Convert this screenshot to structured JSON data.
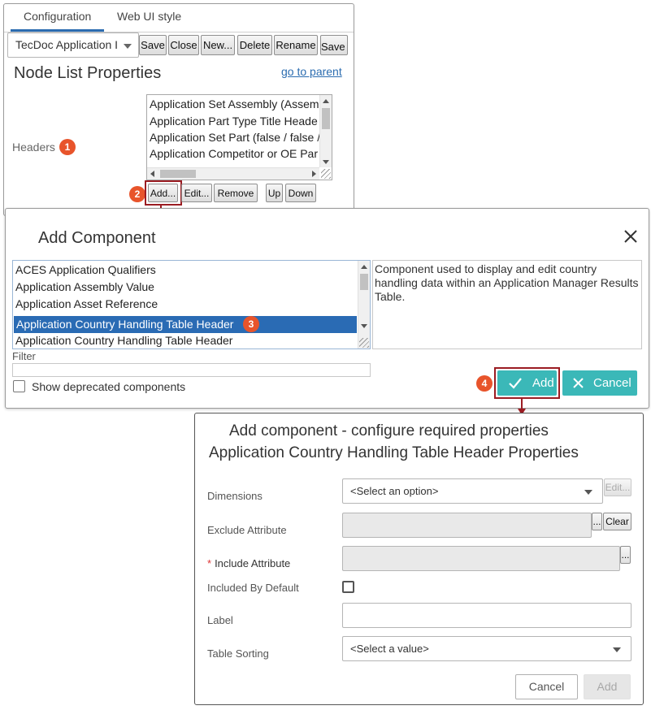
{
  "panel1": {
    "tabs": [
      {
        "label": "Configuration",
        "active": true
      },
      {
        "label": "Web UI style",
        "active": false
      }
    ],
    "app_select": "TecDoc Application I",
    "toolbar": {
      "save": "Save",
      "close": "Close",
      "new": "New...",
      "delete": "Delete",
      "rename": "Rename",
      "save_as": "Save as"
    },
    "title": "Node List Properties",
    "go_to_parent": "go to parent",
    "headers_label": "Headers",
    "headers_list": [
      "Application Set Assembly (Assem",
      "Application Part Type Title Heade",
      "Application Set Part (false / false /",
      "Application Competitor or OE Par"
    ],
    "list_buttons": {
      "add": "Add...",
      "edit": "Edit...",
      "remove": "Remove",
      "up": "Up",
      "down": "Down"
    }
  },
  "callouts": {
    "one": "1",
    "two": "2",
    "three": "3",
    "four": "4",
    "color": "#e8542b",
    "highlight_color": "#9b1c22"
  },
  "dialog": {
    "title": "Add Component",
    "components": [
      "ACES Application Qualifiers",
      "Application Assembly Value",
      "Application Asset Reference",
      "Application Country Handling Table Header",
      "Application Country Handling Table Header"
    ],
    "selected_index": 3,
    "description": "Component used to display and edit country handling data within an Application Manager Results Table.",
    "filter_label": "Filter",
    "filter_value": "",
    "show_deprecated_label": "Show deprecated components",
    "add_label": "Add",
    "cancel_label": "Cancel",
    "accent": "#3bb8b8",
    "selection_color": "#2a6bb4"
  },
  "panel3": {
    "title_line1": "Add component - configure required properties",
    "title_line2": "Application Country Handling Table Header Properties",
    "fields": {
      "dimensions_label": "Dimensions",
      "dimensions_value": "<Select an option>",
      "dimensions_edit": "Edit...",
      "exclude_label": "Exclude Attribute",
      "exclude_browse": "...",
      "exclude_clear": "Clear",
      "include_required": "*",
      "include_label": "Include Attribute",
      "include_browse": "...",
      "included_default_label": "Included By Default",
      "label_label": "Label",
      "label_value": "",
      "sorting_label": "Table Sorting",
      "sorting_value": "<Select a value>"
    },
    "cancel_label": "Cancel",
    "add_label": "Add"
  }
}
